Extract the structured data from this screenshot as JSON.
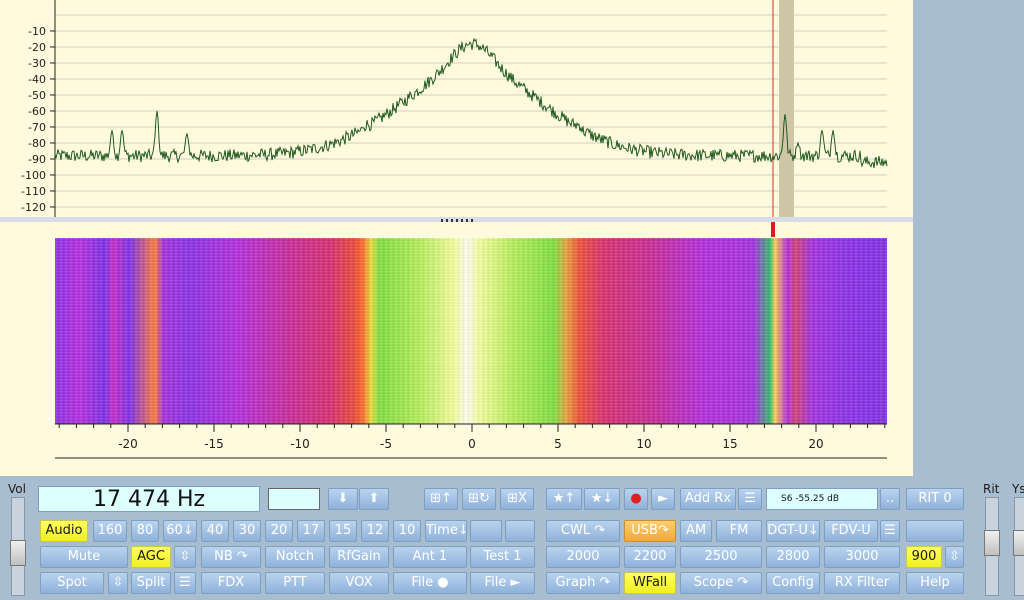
{
  "spectrum": {
    "db_ticks": [
      "-10",
      "-20",
      "-30",
      "-40",
      "-50",
      "-60",
      "-70",
      "-80",
      "-90",
      "-100",
      "-110",
      "-120"
    ],
    "freq_ticks": [
      "-20",
      "-15",
      "-10",
      "-5",
      "0",
      "5",
      "10",
      "15",
      "20"
    ]
  },
  "controls": {
    "vol_label": "Vol",
    "rit_label": "Rit",
    "ys_label": "Ys",
    "frequency": "17 474 Hz",
    "smeter_text": "S6   -55.25 dB",
    "row1": [
      "★↑",
      "★↓",
      "►",
      "Add Rx",
      "..",
      "RIT 0"
    ],
    "bands": [
      "160",
      "80",
      "60↓",
      "40",
      "30",
      "20",
      "17",
      "15",
      "12",
      "10",
      "Time↓"
    ],
    "audio": "Audio",
    "row3": [
      "Mute",
      "AGC",
      "NB ↷",
      "Notch",
      "RfGain",
      "Ant 1",
      "Test 1"
    ],
    "row4": [
      "Spot",
      "Split",
      "FDX",
      "PTT",
      "VOX",
      "File ●",
      "File ►"
    ],
    "modes": [
      "CWL ↷",
      "USB↷",
      "AM",
      "FM",
      "DGT-U↓",
      "FDV-U"
    ],
    "filters": [
      "2000",
      "2200",
      "2500",
      "2800",
      "3000",
      "900"
    ],
    "row4_right": [
      "Graph ↷",
      "WFall",
      "Scope ↷",
      "Config",
      "RX Filter",
      "Help"
    ]
  },
  "colors": {
    "accent_yellow": "#ffff40",
    "trace": "#1e5a1e",
    "rx_marker": "#c0392b"
  }
}
